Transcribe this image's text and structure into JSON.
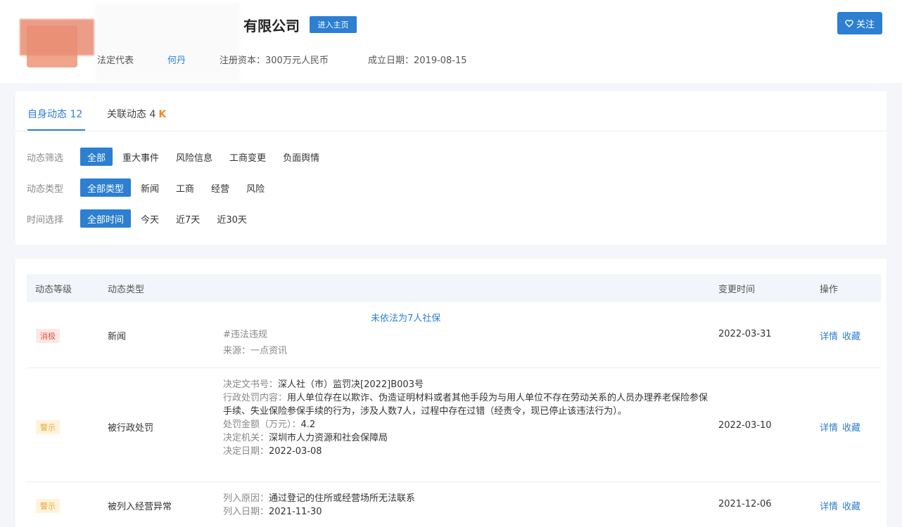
{
  "header": {
    "company_name": "有限公司",
    "home_button": "进入主页",
    "follow_button": "关注",
    "meta": {
      "legal_label": "法定代表",
      "legal_value": "何丹",
      "capital": "注册资本：300万元人民币",
      "founded": "成立日期：2019-08-15"
    }
  },
  "tabs": [
    {
      "label": "自身动态 12"
    },
    {
      "label": "关联动态 4",
      "hot": "K"
    }
  ],
  "filters": {
    "filter_row": {
      "label": "动态筛选",
      "options": [
        "全部",
        "重大事件",
        "风险信息",
        "工商变更",
        "负面舆情"
      ],
      "selected": "全部"
    },
    "type_row": {
      "label": "动态类型",
      "options": [
        "全部类型",
        "新闻",
        "工商",
        "经营",
        "风险"
      ],
      "selected": "全部类型"
    },
    "time_row": {
      "label": "时间选择",
      "options": [
        "全部时间",
        "今天",
        "近7天",
        "近30天"
      ],
      "selected": "全部时间"
    }
  },
  "table": {
    "headers": [
      "动态等级",
      "动态类型",
      "变更时间",
      "操作"
    ],
    "ops": [
      "详情",
      "收藏"
    ],
    "rows": [
      {
        "level": "消极",
        "type": "新闻",
        "date": "2022-03-31",
        "title": "未依法为7人社保",
        "sub": "#违法违规",
        "source": "来源：一点资讯"
      },
      {
        "level": "警示",
        "type": "被行政处罚",
        "date": "2022-03-10",
        "lines": [
          {
            "label": "决定文书号：",
            "value": "深人社（市）监罚决[2022]B003号"
          },
          {
            "label": "行政处罚内容：",
            "value": "用人单位存在以欺诈、伪造证明材料或者其他手段为与用人单位不存在劳动关系的人员办理养老保险参保手续、失业保险参保手续的行为，涉及人数7人，过程中存在过错（经责令，现已停止该违法行为）。"
          },
          {
            "label": "处罚金额（万元）：",
            "value": "4.2"
          },
          {
            "label": "决定机关：",
            "value": "深圳市人力资源和社会保障局"
          },
          {
            "label": "决定日期：",
            "value": "2022-03-08"
          }
        ]
      },
      {
        "level": "警示",
        "type": "被列入经营异常",
        "date": "2021-12-06",
        "lines": [
          {
            "label": "列入原因：",
            "value": "通过登记的住所或经营场所无法联系"
          },
          {
            "label": "列入日期：",
            "value": "2021-11-30"
          }
        ]
      }
    ]
  },
  "colors": {
    "accent": "#2c7fd1",
    "negative": "#e0513f",
    "warning": "#e7a537"
  }
}
